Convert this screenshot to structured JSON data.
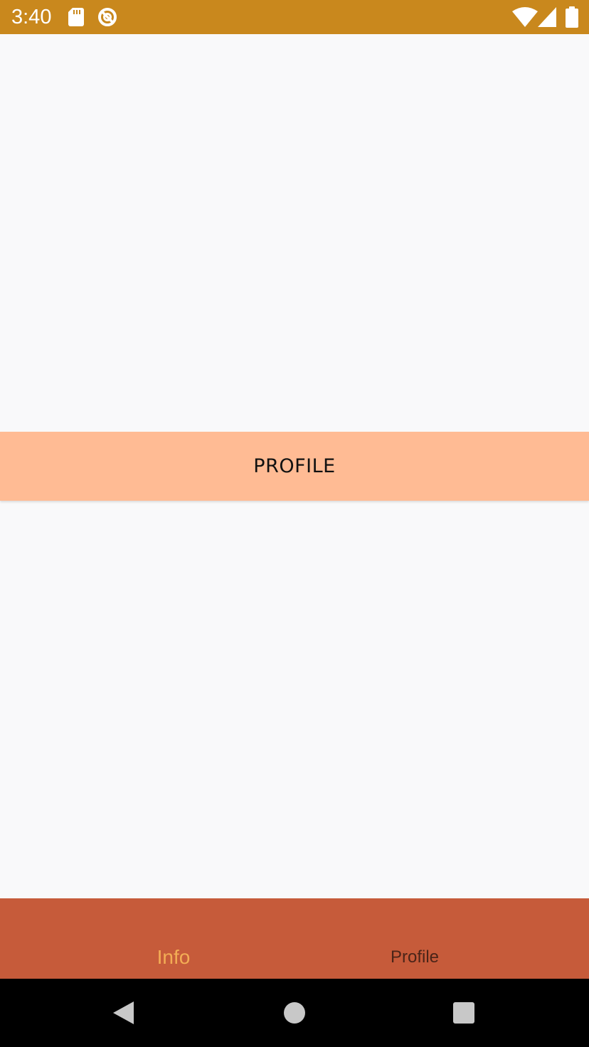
{
  "status_bar": {
    "time": "3:40",
    "icons": [
      "sd-card-icon",
      "sync-icon",
      "wifi-icon",
      "cell-signal-icon",
      "battery-icon"
    ],
    "background": "#c9881d"
  },
  "main": {
    "profile_button_label": "PROFILE",
    "profile_button_color": "#ffbb94",
    "background": "#f9f9fa"
  },
  "bottom_nav": {
    "background": "#c65b3a",
    "tabs": [
      {
        "label": "Info",
        "active": true,
        "color": "#f3ad55"
      },
      {
        "label": "Profile",
        "active": false,
        "color": "#4a2418"
      }
    ]
  },
  "system_nav": {
    "buttons": [
      "back-icon",
      "home-icon",
      "recents-icon"
    ]
  }
}
